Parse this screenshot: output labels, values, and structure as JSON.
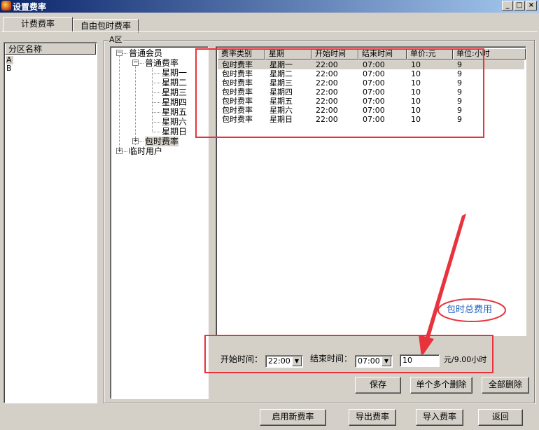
{
  "window": {
    "title": "设置费率"
  },
  "tabs": [
    {
      "label": "计费费率"
    },
    {
      "label": "自由包时费率"
    }
  ],
  "zones": {
    "header": "分区名称",
    "items": [
      "A",
      "B"
    ]
  },
  "tree": {
    "group_label": "A区",
    "nodes": {
      "member": "普通会员",
      "normal_rate": "普通费率",
      "days": [
        "星期一",
        "星期二",
        "星期三",
        "星期四",
        "星期五",
        "星期六",
        "星期日"
      ],
      "package_rate": "包时费率",
      "temp_user": "临时用户"
    }
  },
  "rate_table": {
    "columns": [
      "费率类别",
      "星期",
      "开始时间",
      "结束时间",
      "单价:元",
      "单位:小时"
    ],
    "rows": [
      [
        "包时费率",
        "星期一",
        "22:00",
        "07:00",
        "10",
        "9"
      ],
      [
        "包时费率",
        "星期二",
        "22:00",
        "07:00",
        "10",
        "9"
      ],
      [
        "包时费率",
        "星期三",
        "22:00",
        "07:00",
        "10",
        "9"
      ],
      [
        "包时费率",
        "星期四",
        "22:00",
        "07:00",
        "10",
        "9"
      ],
      [
        "包时费率",
        "星期五",
        "22:00",
        "07:00",
        "10",
        "9"
      ],
      [
        "包时费率",
        "星期六",
        "22:00",
        "07:00",
        "10",
        "9"
      ],
      [
        "包时费率",
        "星期日",
        "22:00",
        "07:00",
        "10",
        "9"
      ]
    ]
  },
  "form": {
    "start_label": "开始时间：",
    "start_value": "22:00",
    "end_label": "结束时间：",
    "end_value": "07:00",
    "price_value": "10",
    "unit_suffix": "元/9.00小时"
  },
  "annotation": {
    "callout": "包时总费用",
    "color": "#e8323c",
    "text_color": "#2060c0"
  },
  "buttons": {
    "save": "保存",
    "delete_multi": "单个多个删除",
    "delete_all": "全部删除",
    "enable_new": "启用新费率",
    "export": "导出费率",
    "import": "导入费率",
    "back": "返回"
  }
}
